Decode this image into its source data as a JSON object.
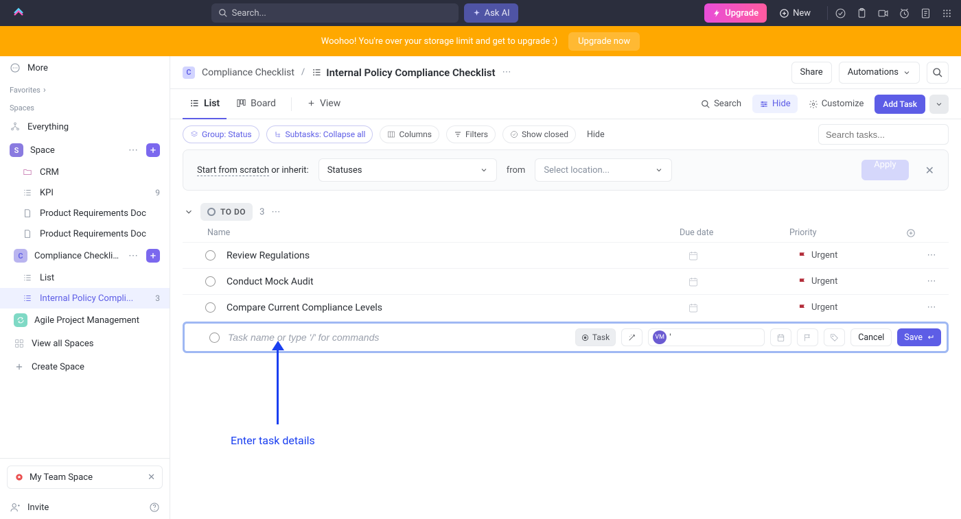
{
  "topbar": {
    "search_placeholder": "Search...",
    "ask_ai": "Ask AI",
    "upgrade": "Upgrade",
    "new": "New"
  },
  "banner": {
    "text": "Woohoo! You're over your storage limit and get to upgrade :)",
    "cta": "Upgrade now"
  },
  "sidebar": {
    "more": "More",
    "favorites": "Favorites",
    "spaces": "Spaces",
    "everything": "Everything",
    "space_label": "Space",
    "items": [
      {
        "label": "CRM"
      },
      {
        "label": "KPI",
        "count": "9"
      },
      {
        "label": "Product Requirements Doc"
      },
      {
        "label": "Product Requirements Doc"
      }
    ],
    "compliance": "Compliance Checklist",
    "list": "List",
    "internal_policy": "Internal Policy Compli...",
    "internal_policy_count": "3",
    "agile": "Agile Project Management",
    "view_all": "View all Spaces",
    "create_space": "Create Space",
    "team_space": "My Team Space",
    "invite": "Invite"
  },
  "header": {
    "crumb_space": "Compliance Checklist",
    "crumb_title": "Internal Policy Compliance Checklist",
    "share": "Share",
    "automations": "Automations"
  },
  "views": {
    "list": "List",
    "board": "Board",
    "add_view": "View",
    "right": {
      "search": "Search",
      "hide": "Hide",
      "customize": "Customize",
      "add_task": "Add Task"
    }
  },
  "chips": {
    "group": "Group: Status",
    "subtasks": "Subtasks: Collapse all",
    "columns": "Columns",
    "filters": "Filters",
    "show_closed": "Show closed",
    "hide": "Hide",
    "search_placeholder": "Search tasks..."
  },
  "inherit": {
    "start": "Start from scratch",
    "or_inherit": " or inherit:",
    "statuses": "Statuses",
    "from": "from",
    "select_location": "Select location...",
    "apply": "Apply"
  },
  "group": {
    "status": "TO DO",
    "count": "3"
  },
  "columns": [
    "Name",
    "Due date",
    "Priority"
  ],
  "tasks": [
    {
      "name": "Review Regulations",
      "priority": "Urgent"
    },
    {
      "name": "Conduct Mock Audit",
      "priority": "Urgent"
    },
    {
      "name": "Compare Current Compliance Levels",
      "priority": "Urgent"
    }
  ],
  "new_task": {
    "placeholder": "Task name or type '/' for commands",
    "task_chip": "Task",
    "assignee_text": "'",
    "cancel": "Cancel",
    "save": "Save"
  },
  "annotation": "Enter task details"
}
